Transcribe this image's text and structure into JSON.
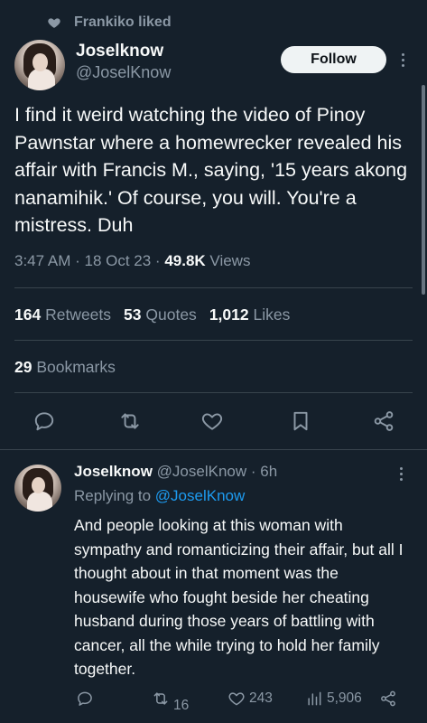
{
  "liked_by": "Frankiko liked",
  "tweet": {
    "author_name": "Joselknow",
    "author_handle": "@JoselKnow",
    "follow_label": "Follow",
    "text": "I find it weird watching the video of Pinoy Pawnstar where a homewrecker revealed his affair with Francis M., saying, '15 years akong nanamihik.' Of course, you will. You're a mistress. Duh",
    "time": "3:47 AM",
    "date": "18 Oct 23",
    "views_count": "49.8K",
    "views_label": "Views",
    "retweets_count": "164",
    "retweets_label": "Retweets",
    "quotes_count": "53",
    "quotes_label": "Quotes",
    "likes_count": "1,012",
    "likes_label": "Likes",
    "bookmarks_count": "29",
    "bookmarks_label": "Bookmarks"
  },
  "actions": {
    "icons": [
      "reply-icon",
      "retweet-icon",
      "like-icon",
      "bookmark-icon",
      "share-icon"
    ]
  },
  "reply": {
    "author_name": "Joselknow",
    "author_handle": "@JoselKnow",
    "age": "6h",
    "replying_prefix": "Replying to",
    "replying_to": "@JoselKnow",
    "text": "And people looking at this woman with sympathy and romanticizing their affair, but all I thought about in that moment was the housewife who fought beside her cheating husband during those years of battling with cancer, all the while trying to hold her family together.",
    "retweets": "16",
    "likes": "243",
    "views": "5,906"
  },
  "colors": {
    "background": "#15202b",
    "text": "#f7f9f9",
    "muted": "#8b98a5",
    "link": "#1d9bf0",
    "divider": "#38444d"
  }
}
